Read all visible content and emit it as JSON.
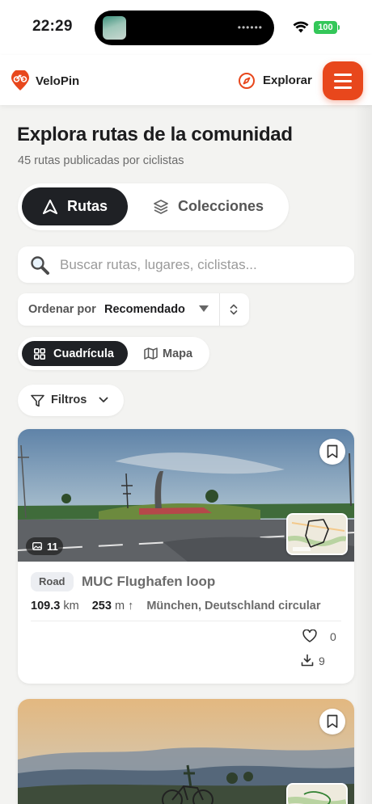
{
  "status_bar": {
    "time": "22:29",
    "battery": "100"
  },
  "header": {
    "brand": "VeloPin",
    "explore": "Explorar"
  },
  "page": {
    "title": "Explora rutas de la comunidad",
    "subtitle": "45 rutas publicadas por ciclistas"
  },
  "segments": {
    "routes": "Rutas",
    "collections": "Colecciones"
  },
  "search": {
    "placeholder": "Buscar rutas, lugares, ciclistas..."
  },
  "sort": {
    "label": "Ordenar por",
    "value": "Recomendado"
  },
  "view": {
    "grid": "Cuadrícula",
    "map": "Mapa"
  },
  "filters": {
    "label": "Filtros"
  },
  "routes": [
    {
      "photo_count": "11",
      "type": "Road",
      "name": "MUC Flughafen loop",
      "distance": "109.3",
      "distance_unit": "km",
      "elevation": "253",
      "elevation_unit": "m ↑",
      "location": "München, Deutschland circular",
      "likes": "0",
      "downloads": "9"
    }
  ],
  "colors": {
    "accent": "#e8471c",
    "dark": "#1f2125"
  }
}
